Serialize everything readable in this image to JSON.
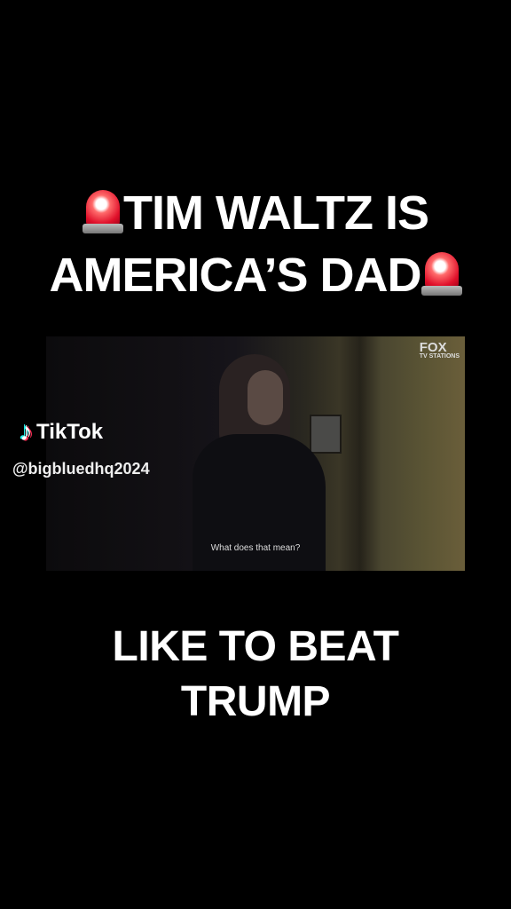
{
  "headline": {
    "line1": "TIM WALTZ IS",
    "line2": "AMERICA’S DAD",
    "icon": "police-siren-emoji"
  },
  "video": {
    "watermark": "FOX",
    "watermark_sub": "TV STATIONS",
    "subtitle": "What does that mean?"
  },
  "tiktok": {
    "brand": "TikTok",
    "handle": "@bigbluedhq2024"
  },
  "caption": {
    "line1": "LIKE TO BEAT",
    "line2": "TRUMP"
  }
}
